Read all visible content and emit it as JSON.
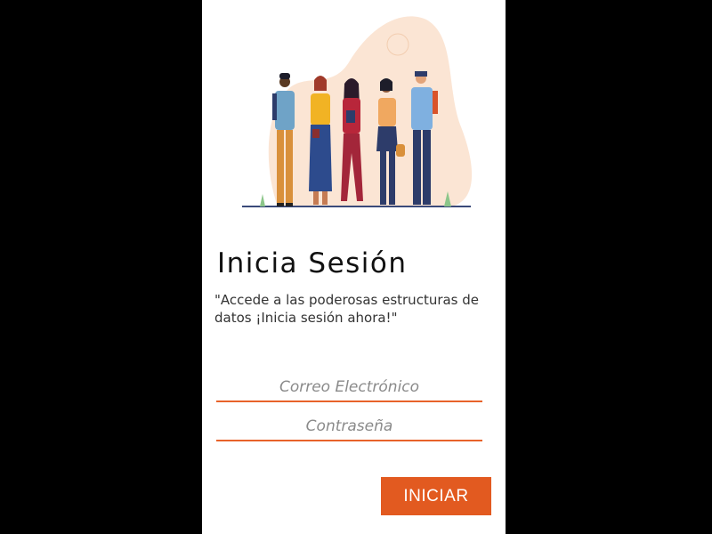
{
  "login": {
    "title": "Inicia Sesión",
    "subtitle": "\"Accede a las poderosas estructuras de datos ¡Inicia sesión ahora!\"",
    "email_placeholder": "Correo Electrónico",
    "password_placeholder": "Contraseña",
    "submit_label": "INICIAR"
  },
  "colors": {
    "accent": "#e25a20",
    "underline": "#e8622a",
    "blob": "#fbe5d4",
    "background": "#000000"
  },
  "icons": [
    "people-group-illustration"
  ]
}
